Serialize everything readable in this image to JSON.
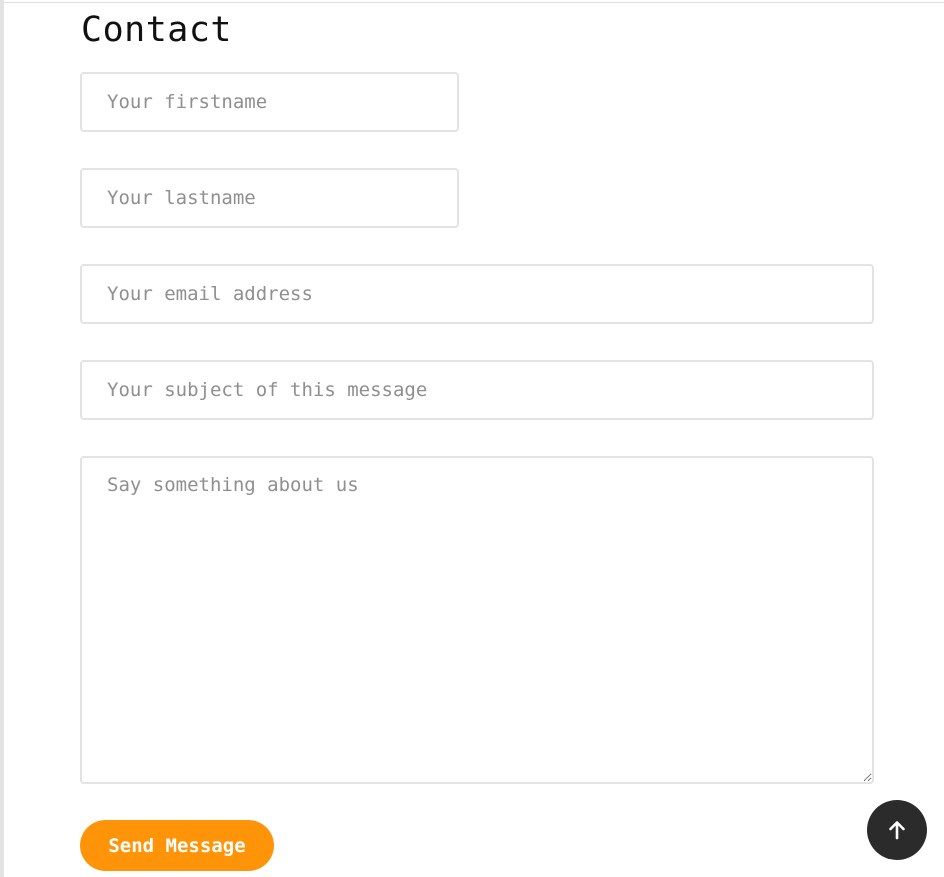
{
  "contact": {
    "title": "Contact",
    "firstname_placeholder": "Your firstname",
    "lastname_placeholder": "Your lastname",
    "email_placeholder": "Your email address",
    "subject_placeholder": "Your subject of this message",
    "message_placeholder": "Say something about us",
    "send_label": "Send Message"
  },
  "scroll_top": {
    "icon": "arrow-up-icon"
  },
  "colors": {
    "accent": "#ff9408",
    "scroll_button": "#2b2b2b",
    "border": "#e3e3e3",
    "placeholder": "#8f8f8f"
  }
}
